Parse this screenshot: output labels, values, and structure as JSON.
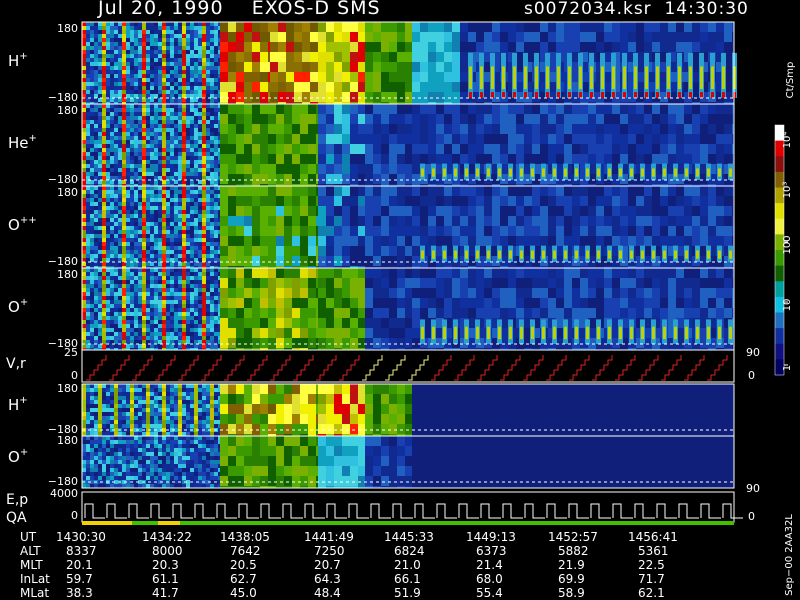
{
  "header": {
    "left": "Jul 20, 1990    EXOS-D SMS",
    "right": "s0072034.ksr  14:30:30"
  },
  "panels": [
    {
      "label": "H",
      "sup": "+",
      "ymax": "180",
      "ymin": "−180",
      "scheme": "h"
    },
    {
      "label": "He",
      "sup": "+",
      "ymax": "180",
      "ymin": "−180",
      "scheme": "he"
    },
    {
      "label": "O",
      "sup": "++",
      "ymax": "180",
      "ymin": "−180",
      "scheme": "opp"
    },
    {
      "label": "O",
      "sup": "+",
      "ymax": "180",
      "ymin": "−180",
      "scheme": "op"
    }
  ],
  "vr_panel": {
    "label": "V,r",
    "ymax": "25",
    "ymin": "0",
    "right_top": "90",
    "right_bottom": "0"
  },
  "lower_panels": [
    {
      "label": "H",
      "sup": "+",
      "ymax": "180",
      "ymin": "−180",
      "scheme": "h2"
    },
    {
      "label": "O",
      "sup": "+",
      "ymax": "180",
      "ymin": "−180",
      "scheme": "o2",
      "right_top": "90"
    }
  ],
  "ep_panel": {
    "label1": "E,p",
    "label2": "QA",
    "ymax": "4000",
    "ymin": "0",
    "right_bottom": "0"
  },
  "colorbar": {
    "unit": "Ct/Smp",
    "ticks": [
      {
        "label": "10⁴",
        "value": 10000
      },
      {
        "label": "10³",
        "value": 1000
      },
      {
        "label": "100",
        "value": 100
      },
      {
        "label": "10",
        "value": 10
      },
      {
        "label": "1",
        "value": 1
      }
    ],
    "colors": [
      "#ffffff",
      "#e00000",
      "#8a1010",
      "#806000",
      "#b0a000",
      "#e0e000",
      "#f0f040",
      "#7ab000",
      "#3a9a00",
      "#106000",
      "#00a0a0",
      "#10c0e0",
      "#2070c0",
      "#1030a0",
      "#101080",
      "#000060"
    ]
  },
  "footer_code": "Sep−00 2AA32L",
  "table": {
    "rows": [
      {
        "label": "UT",
        "values": [
          "1430:30",
          "1434:22",
          "1438:05",
          "1441:49",
          "1445:33",
          "1449:13",
          "1452:57",
          "1456:41"
        ]
      },
      {
        "label": "ALT",
        "values": [
          "8337",
          "8000",
          "7642",
          "7250",
          "6824",
          "6373",
          "5882",
          "5361"
        ]
      },
      {
        "label": "MLT",
        "values": [
          "20.1",
          "20.3",
          "20.5",
          "20.7",
          "21.0",
          "21.4",
          "21.9",
          "22.5"
        ]
      },
      {
        "label": "InLat",
        "values": [
          "59.7",
          "61.1",
          "62.7",
          "64.3",
          "66.1",
          "68.0",
          "69.9",
          "71.7"
        ]
      },
      {
        "label": "MLat",
        "values": [
          "38.3",
          "41.7",
          "45.0",
          "48.4",
          "51.9",
          "55.4",
          "58.9",
          "62.1"
        ]
      }
    ]
  },
  "chart_data": {
    "type": "heatmap",
    "title": "Jul 20, 1990 EXOS-D SMS",
    "x_ticks": [
      "1430:30",
      "1434:22",
      "1438:05",
      "1441:49",
      "1445:33",
      "1449:13",
      "1452:57",
      "1456:41"
    ],
    "series": [
      {
        "name": "H+",
        "ylim": [
          -180,
          180
        ]
      },
      {
        "name": "He+",
        "ylim": [
          -180,
          180
        ]
      },
      {
        "name": "O++",
        "ylim": [
          -180,
          180
        ]
      },
      {
        "name": "O+",
        "ylim": [
          -180,
          180
        ]
      },
      {
        "name": "V,r",
        "ylim": [
          0,
          25
        ]
      },
      {
        "name": "H+",
        "ylim": [
          -180,
          180
        ]
      },
      {
        "name": "O+",
        "ylim": [
          -180,
          180
        ]
      },
      {
        "name": "E,p",
        "ylim": [
          0,
          4000
        ]
      }
    ],
    "colorbar_unit": "Ct/Smp",
    "colorbar_range": [
      1,
      10000
    ],
    "colorbar_scale": "log"
  }
}
